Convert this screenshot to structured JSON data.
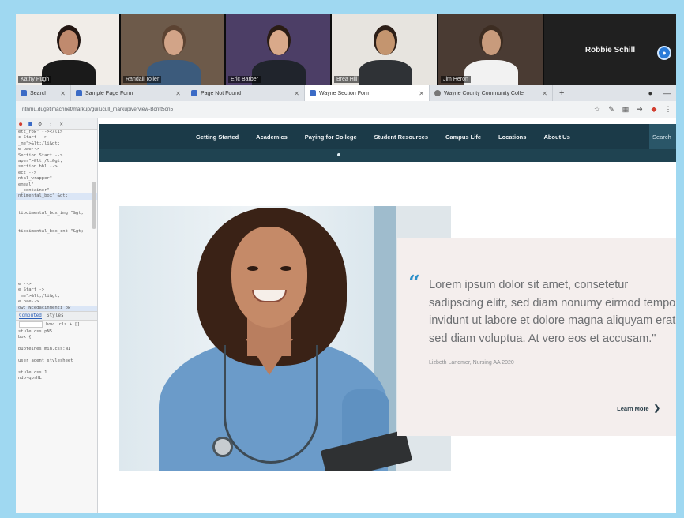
{
  "meeting": {
    "participants": [
      {
        "name": "Kathy Pugh",
        "tone": "#f1ede8",
        "skin": "#c08a6e",
        "hair": "#231612",
        "shirt": "#1a1a1a",
        "width": 133
      },
      {
        "name": "Randall Toller",
        "tone": "#6d5a4a",
        "skin": "#d2a488",
        "hair": "#5c4332",
        "shirt": "#3c5b7c",
        "width": 133
      },
      {
        "name": "Eric Barber",
        "tone": "#4c3e66",
        "skin": "#d9a98a",
        "hair": "#2a1c14",
        "shirt": "#20242c",
        "width": 134
      },
      {
        "name": "Brea Hill",
        "tone": "#e7e4df",
        "skin": "#c4956f",
        "hair": "#2d1f18",
        "shirt": "#2f3236",
        "width": 135
      },
      {
        "name": "Jim Heron",
        "tone": "#4a3b33",
        "skin": "#c89b7c",
        "hair": "#3d2d22",
        "shirt": "#f2f2f2",
        "width": 134
      }
    ],
    "featured_name": "Robbie Schill"
  },
  "browser": {
    "tabs": [
      {
        "label": "Search",
        "active": false,
        "icon": "page-icon"
      },
      {
        "label": "Sample Page Form",
        "active": false,
        "icon": "vscode-icon"
      },
      {
        "label": "Page Not Found",
        "active": false,
        "icon": "vscode-icon"
      },
      {
        "label": "Wayne Section Form",
        "active": true,
        "icon": "page-icon"
      },
      {
        "label": "Wayne County Community Colle",
        "active": false,
        "icon": "globe-icon"
      }
    ],
    "url": "ntnmu.dugetimachnet/markup/guilucull_markupiverview-Bcntt5cn5"
  },
  "devtools": {
    "lines": [
      "ett_row\" --></li>",
      "c Start -->",
      "_me\">&lt;/li&gt;",
      "e bae-->",
      "Section Start -->",
      "aper\">&lt;/li&gt;",
      "section bbl -->",
      "ect -->",
      "ntal_wrapper\"",
      "emeal\"",
      "-_container\"",
      "ntimental_box\" &gt;",
      "",
      "",
      "tiocimental_box_img \"&gt;",
      "",
      "",
      "tiocimental_box_cnt \"&gt;"
    ],
    "lines_lower": [
      "e -->",
      "e Start ->",
      "_me\">&lt;/li&gt;",
      "e bae-->",
      "ow: Ncedacinmenti_ow"
    ],
    "panel_tabs": [
      "Computed",
      "Styles"
    ],
    "filter_label": "hov .cls + []",
    "code_lower": [
      "stule.css:pN5",
      "box {",
      "",
      "bubteines.min.css:N1",
      "",
      "user agent stylesheet",
      "",
      "stule.css:1",
      "ndo-qprHL"
    ]
  },
  "site": {
    "nav": [
      "Getting Started",
      "Academics",
      "Paying for College",
      "Student Resources",
      "Campus Life",
      "Locations",
      "About Us"
    ],
    "search_label": "Search",
    "quote": {
      "text": "Lorem ipsum dolor sit amet, consetetur sadipscing elitr, sed diam nonumy eirmod tempor invidunt ut labore et dolore magna aliquyam erat, sed diam voluptua. At vero eos et accusam.\"",
      "author": "Lizbeth Landmer, Nursing AA 2020",
      "cta": "Learn More"
    },
    "colors": {
      "nav": "#1b3a48",
      "accent": "#2d8fc9",
      "card": "#f4eeed"
    }
  }
}
